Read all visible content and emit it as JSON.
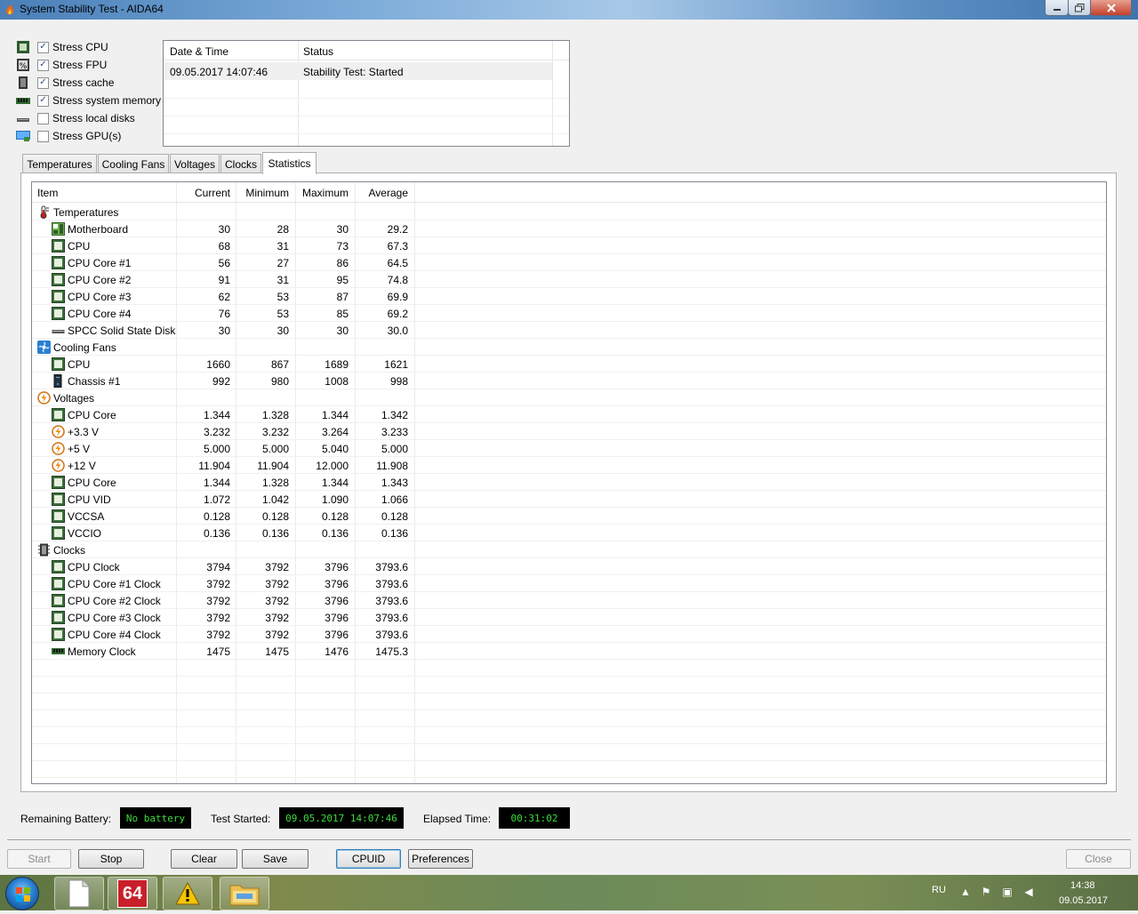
{
  "window": {
    "title": "System Stability Test - AIDA64"
  },
  "stress_options": [
    {
      "label": "Stress CPU",
      "checked": true,
      "icon": "cpu-icon"
    },
    {
      "label": "Stress FPU",
      "checked": true,
      "icon": "fpu-icon"
    },
    {
      "label": "Stress cache",
      "checked": true,
      "icon": "cache-icon"
    },
    {
      "label": "Stress system memory",
      "checked": true,
      "icon": "memory-icon"
    },
    {
      "label": "Stress local disks",
      "checked": false,
      "icon": "disk-icon"
    },
    {
      "label": "Stress GPU(s)",
      "checked": false,
      "icon": "monitor-icon"
    }
  ],
  "log": {
    "columns": [
      "Date & Time",
      "Status"
    ],
    "rows": [
      {
        "datetime": "09.05.2017 14:07:46",
        "status": "Stability Test: Started"
      }
    ]
  },
  "tabs": [
    "Temperatures",
    "Cooling Fans",
    "Voltages",
    "Clocks",
    "Statistics"
  ],
  "active_tab": "Statistics",
  "stats": {
    "columns": [
      "Item",
      "Current",
      "Minimum",
      "Maximum",
      "Average"
    ],
    "rows": [
      {
        "group": true,
        "label": "Temperatures",
        "icon": "thermometer-icon"
      },
      {
        "label": "Motherboard",
        "icon": "motherboard-icon",
        "cur": "30",
        "min": "28",
        "max": "30",
        "avg": "29.2"
      },
      {
        "label": "CPU",
        "icon": "chip-icon",
        "cur": "68",
        "min": "31",
        "max": "73",
        "avg": "67.3"
      },
      {
        "label": "CPU Core #1",
        "icon": "chip-icon",
        "cur": "56",
        "min": "27",
        "max": "86",
        "avg": "64.5"
      },
      {
        "label": "CPU Core #2",
        "icon": "chip-icon",
        "cur": "91",
        "min": "31",
        "max": "95",
        "avg": "74.8"
      },
      {
        "label": "CPU Core #3",
        "icon": "chip-icon",
        "cur": "62",
        "min": "53",
        "max": "87",
        "avg": "69.9"
      },
      {
        "label": "CPU Core #4",
        "icon": "chip-icon",
        "cur": "76",
        "min": "53",
        "max": "85",
        "avg": "69.2"
      },
      {
        "label": "SPCC Solid State Disk",
        "icon": "disk-icon",
        "cur": "30",
        "min": "30",
        "max": "30",
        "avg": "30.0"
      },
      {
        "group": true,
        "label": "Cooling Fans",
        "icon": "fan-icon"
      },
      {
        "label": "CPU",
        "icon": "chip-icon",
        "cur": "1660",
        "min": "867",
        "max": "1689",
        "avg": "1621"
      },
      {
        "label": "Chassis #1",
        "icon": "chassis-icon",
        "cur": "992",
        "min": "980",
        "max": "1008",
        "avg": "998"
      },
      {
        "group": true,
        "label": "Voltages",
        "icon": "voltage-icon"
      },
      {
        "label": "CPU Core",
        "icon": "chip-icon",
        "cur": "1.344",
        "min": "1.328",
        "max": "1.344",
        "avg": "1.342"
      },
      {
        "label": "+3.3 V",
        "icon": "voltage-icon",
        "cur": "3.232",
        "min": "3.232",
        "max": "3.264",
        "avg": "3.233"
      },
      {
        "label": "+5 V",
        "icon": "voltage-icon",
        "cur": "5.000",
        "min": "5.000",
        "max": "5.040",
        "avg": "5.000"
      },
      {
        "label": "+12 V",
        "icon": "voltage-icon",
        "cur": "11.904",
        "min": "11.904",
        "max": "12.000",
        "avg": "11.908"
      },
      {
        "label": "CPU Core",
        "icon": "chip-icon",
        "cur": "1.344",
        "min": "1.328",
        "max": "1.344",
        "avg": "1.343"
      },
      {
        "label": "CPU VID",
        "icon": "chip-icon",
        "cur": "1.072",
        "min": "1.042",
        "max": "1.090",
        "avg": "1.066"
      },
      {
        "label": "VCCSA",
        "icon": "chip-icon",
        "cur": "0.128",
        "min": "0.128",
        "max": "0.128",
        "avg": "0.128"
      },
      {
        "label": "VCCIO",
        "icon": "chip-icon",
        "cur": "0.136",
        "min": "0.136",
        "max": "0.136",
        "avg": "0.136"
      },
      {
        "group": true,
        "label": "Clocks",
        "icon": "clock-chip-icon"
      },
      {
        "label": "CPU Clock",
        "icon": "chip-icon",
        "cur": "3794",
        "min": "3792",
        "max": "3796",
        "avg": "3793.6"
      },
      {
        "label": "CPU Core #1 Clock",
        "icon": "chip-icon",
        "cur": "3792",
        "min": "3792",
        "max": "3796",
        "avg": "3793.6"
      },
      {
        "label": "CPU Core #2 Clock",
        "icon": "chip-icon",
        "cur": "3792",
        "min": "3792",
        "max": "3796",
        "avg": "3793.6"
      },
      {
        "label": "CPU Core #3 Clock",
        "icon": "chip-icon",
        "cur": "3792",
        "min": "3792",
        "max": "3796",
        "avg": "3793.6"
      },
      {
        "label": "CPU Core #4 Clock",
        "icon": "chip-icon",
        "cur": "3792",
        "min": "3792",
        "max": "3796",
        "avg": "3793.6"
      },
      {
        "label": "Memory Clock",
        "icon": "memory-icon",
        "cur": "1475",
        "min": "1475",
        "max": "1476",
        "avg": "1475.3"
      }
    ]
  },
  "status": {
    "battery_label": "Remaining Battery:",
    "battery_value": "No battery",
    "started_label": "Test Started:",
    "started_value": "09.05.2017 14:07:46",
    "elapsed_label": "Elapsed Time:",
    "elapsed_value": "00:31:02",
    "lcd_color": "#3cdc3c"
  },
  "buttons": {
    "start": "Start",
    "stop": "Stop",
    "clear": "Clear",
    "save": "Save",
    "cpuid": "CPUID",
    "preferences": "Preferences",
    "close": "Close"
  },
  "taskbar": {
    "apps": [
      "blank-document-icon",
      "aida64-icon",
      "warning-icon",
      "folder-icon"
    ],
    "aida_badge": "64",
    "language": "RU",
    "time": "14:38",
    "date": "09.05.2017"
  }
}
